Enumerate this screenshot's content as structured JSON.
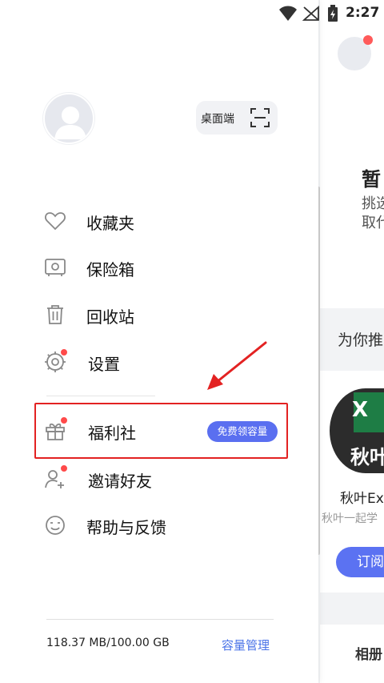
{
  "status_bar": {
    "time": "2:27"
  },
  "background": {
    "empty_title": "暂",
    "empty_sub_1": "挑选",
    "empty_sub_2": "取代",
    "recommend_title": "为你推",
    "book": {
      "name": "秋叶Ex",
      "author": "秋叶一起学",
      "cover_text": "秋叶",
      "cover_letter": "X"
    },
    "subscribe_label": "订阅",
    "bottom_tab": "相册"
  },
  "drawer": {
    "desktop_button_label": "桌面端",
    "menu": [
      {
        "label": "收藏夹",
        "icon": "heart-icon"
      },
      {
        "label": "保险箱",
        "icon": "safe-icon"
      },
      {
        "label": "回收站",
        "icon": "trash-icon"
      },
      {
        "label": "设置",
        "icon": "gear-icon"
      },
      {
        "label": "福利社",
        "icon": "gift-icon"
      },
      {
        "label": "邀请好友",
        "icon": "add-user-icon"
      },
      {
        "label": "帮助与反馈",
        "icon": "smile-icon"
      }
    ],
    "promo_badge": "免费领容量",
    "storage": {
      "usage": "118.37 MB/100.00 GB",
      "manage_label": "容量管理"
    }
  },
  "colors": {
    "accent": "#4a73e8",
    "badge": "#5a6ff0",
    "alert_dot": "#ff4a4a",
    "highlight": "#e32222"
  }
}
